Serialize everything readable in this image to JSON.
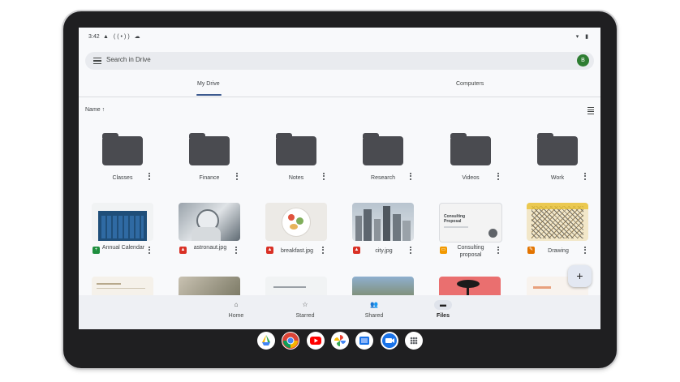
{
  "status_bar": {
    "time": "3:42",
    "left_icons": "▲ ((•)) ☁",
    "right_icons": "▾ ▮"
  },
  "search": {
    "placeholder": "Search in Drive",
    "avatar_letter": "B"
  },
  "tabs": [
    {
      "label": "My Drive",
      "active": true
    },
    {
      "label": "Computers",
      "active": false
    }
  ],
  "sort": {
    "label": "Name ↑"
  },
  "folders": [
    {
      "name": "Classes"
    },
    {
      "name": "Finance"
    },
    {
      "name": "Notes"
    },
    {
      "name": "Research"
    },
    {
      "name": "Videos"
    },
    {
      "name": "Work"
    }
  ],
  "files": [
    {
      "name": "Annual Calendar",
      "type_icon": "sheets-icon",
      "color": "#1e8e3e"
    },
    {
      "name": "astronaut.jpg",
      "type_icon": "image-icon",
      "color": "#d93025"
    },
    {
      "name": "breakfast.jpg",
      "type_icon": "image-icon",
      "color": "#d93025"
    },
    {
      "name": "city.jpg",
      "type_icon": "image-icon",
      "color": "#d93025"
    },
    {
      "name": "Consulting proposal",
      "type_icon": "slides-icon",
      "color": "#f29900"
    },
    {
      "name": "Drawing",
      "type_icon": "drawing-icon",
      "color": "#e37400"
    }
  ],
  "consulting_thumb_text": "Consulting Proposal",
  "fab": {
    "icon": "+"
  },
  "bottom_nav": [
    {
      "label": "Home",
      "icon": "⌂",
      "active": false
    },
    {
      "label": "Starred",
      "icon": "☆",
      "active": false
    },
    {
      "label": "Shared",
      "icon": "👥",
      "active": false
    },
    {
      "label": "Files",
      "icon": "▬",
      "active": true
    }
  ],
  "dock_apps": [
    {
      "name": "drive-icon"
    },
    {
      "name": "chrome-icon"
    },
    {
      "name": "youtube-icon"
    },
    {
      "name": "photos-icon"
    },
    {
      "name": "files-icon"
    },
    {
      "name": "meet-icon"
    },
    {
      "name": "app-launcher-icon"
    }
  ]
}
